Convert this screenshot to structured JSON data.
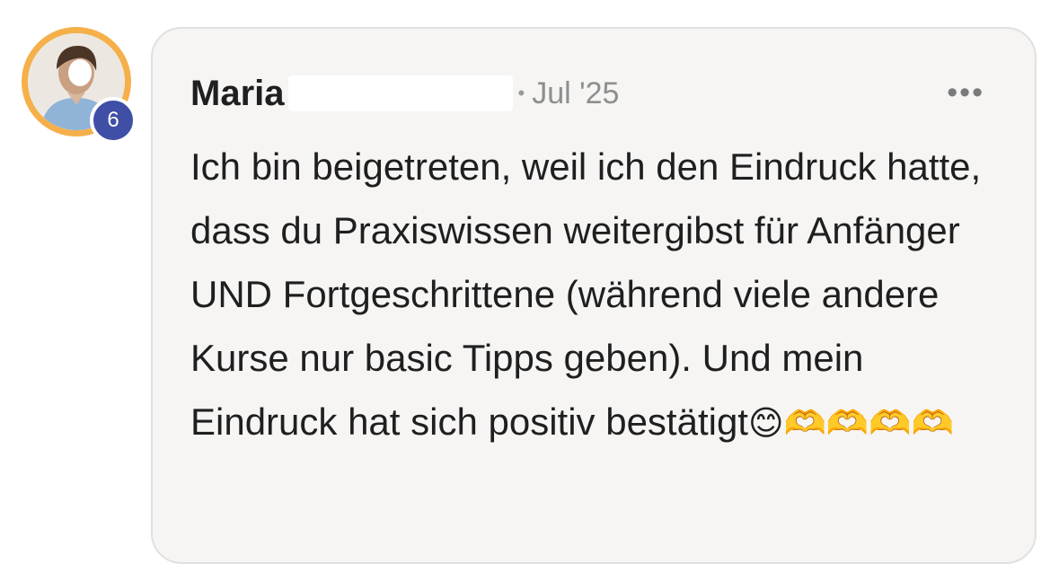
{
  "comment": {
    "author": {
      "first_name": "Maria",
      "badge_level": "6",
      "ring_color": "#f5b04a",
      "badge_color": "#3f4fa6"
    },
    "separator": "•",
    "date": "Jul '25",
    "menu_label": "•••",
    "text": "Ich bin beigetreten, weil ich den Eindruck hatte, dass du Praxiswissen weitergibst für Anfänger UND Fortgeschrittene (während viele andere Kurse nur basic Tipps geben). Und mein Eindruck hat sich positiv bestätigt",
    "emojis": "😊🫶🫶🫶🫶"
  },
  "icons": {
    "avatar": "person-avatar",
    "menu": "more-horizontal-icon"
  }
}
